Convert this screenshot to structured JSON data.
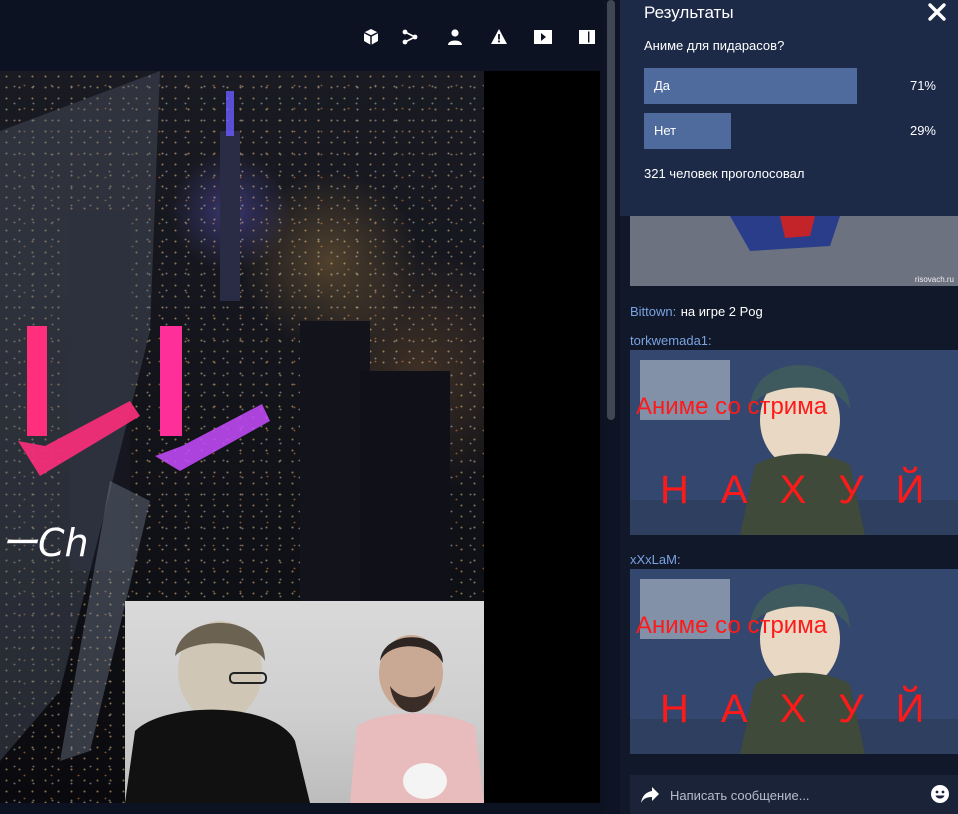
{
  "toolbar": {
    "icons": [
      "cube-icon",
      "share-icon",
      "user-icon",
      "warning-icon",
      "play-icon",
      "layout-icon"
    ]
  },
  "video": {
    "logo_text": "ーCh"
  },
  "poll": {
    "title": "Результаты",
    "question": "Аниме для пидарасов?",
    "options": [
      {
        "label": "Да",
        "percent_text": "71%",
        "fraction": 0.71
      },
      {
        "label": "Нет",
        "percent_text": "29%",
        "fraction": 0.29
      }
    ],
    "total": "321 человек проголосовал"
  },
  "chat": {
    "partial_meme_caption": "risovach.ru",
    "messages": [
      {
        "name": "Bittown:",
        "text": "на игре 2 Pog"
      },
      {
        "name": "torkwemada1:",
        "meme_line1": "Аниме со стрима",
        "meme_line2": "НАХУЙ"
      },
      {
        "name": "xXxLaM:",
        "meme_line1": "Аниме со стрима",
        "meme_line2": "НАХУЙ"
      }
    ],
    "input_placeholder": "Написать сообщение..."
  },
  "colors": {
    "poll_bg": "#1c2a48",
    "poll_bar": "#4f6b9e",
    "username": "#7aa3e0",
    "meme_text": "#ff1a1a"
  }
}
